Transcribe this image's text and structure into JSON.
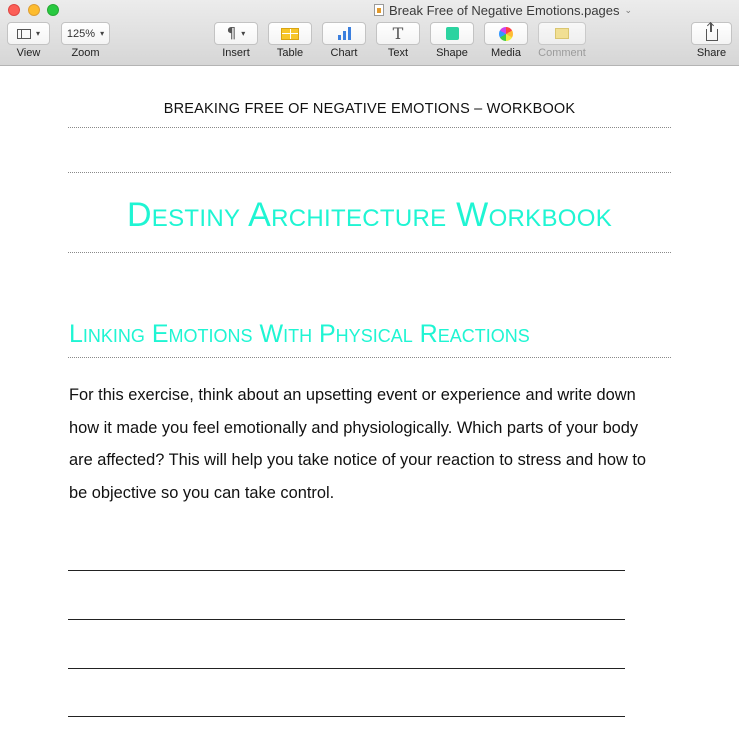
{
  "window": {
    "title": "Break Free of Negative Emotions.pages"
  },
  "toolbar": {
    "view": {
      "label": "View",
      "icon": "sidebar-view-icon"
    },
    "zoom": {
      "label": "Zoom",
      "value": "125%"
    },
    "insert": {
      "label": "Insert",
      "icon": "pilcrow-icon"
    },
    "table": {
      "label": "Table",
      "icon": "table-icon"
    },
    "chart": {
      "label": "Chart",
      "icon": "chart-icon"
    },
    "text": {
      "label": "Text",
      "icon": "text-icon"
    },
    "shape": {
      "label": "Shape",
      "icon": "shape-icon"
    },
    "media": {
      "label": "Media",
      "icon": "media-icon"
    },
    "comment": {
      "label": "Comment",
      "icon": "comment-icon",
      "enabled": false
    },
    "share": {
      "label": "Share",
      "icon": "share-icon"
    }
  },
  "document": {
    "header": "BREAKING FREE OF NEGATIVE EMOTIONS  –  WORKBOOK",
    "title": "Destiny Architecture Workbook",
    "section_heading": "Linking Emotions With Physical Reactions",
    "body": "For this exercise, think about an upsetting event or experience and write down how it made you feel emotionally and physiologically. Which parts of your body are affected? This will help you take notice of your reaction to stress and how to be objective so you can take control.",
    "accent_color": "#1ff5d3",
    "writing_lines": 4
  }
}
